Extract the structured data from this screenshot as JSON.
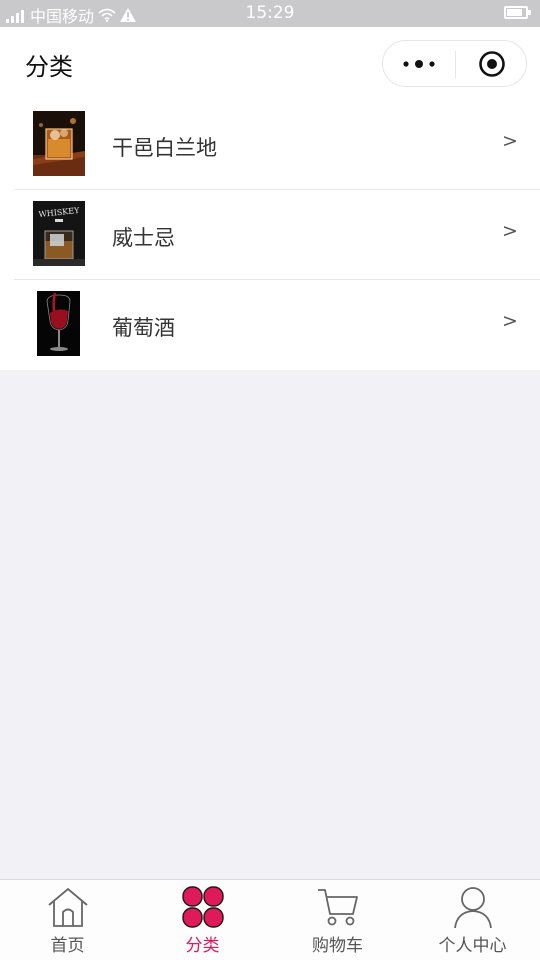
{
  "status_bar": {
    "carrier": "中国移动",
    "time": "15:29"
  },
  "nav": {
    "title": "分类"
  },
  "categories": [
    {
      "label": "干邑白兰地",
      "arrow": ">"
    },
    {
      "label": "威士忌",
      "arrow": ">"
    },
    {
      "label": "葡萄酒",
      "arrow": ">"
    }
  ],
  "thumb_text": {
    "whiskey": "WHISKEY"
  },
  "tabbar": {
    "items": [
      {
        "label": "首页",
        "icon": "home-icon"
      },
      {
        "label": "分类",
        "icon": "category-icon"
      },
      {
        "label": "购物车",
        "icon": "cart-icon"
      },
      {
        "label": "个人中心",
        "icon": "user-icon"
      }
    ],
    "active_index": 1,
    "active_color": "#e0195b",
    "inactive_color": "#555555"
  }
}
